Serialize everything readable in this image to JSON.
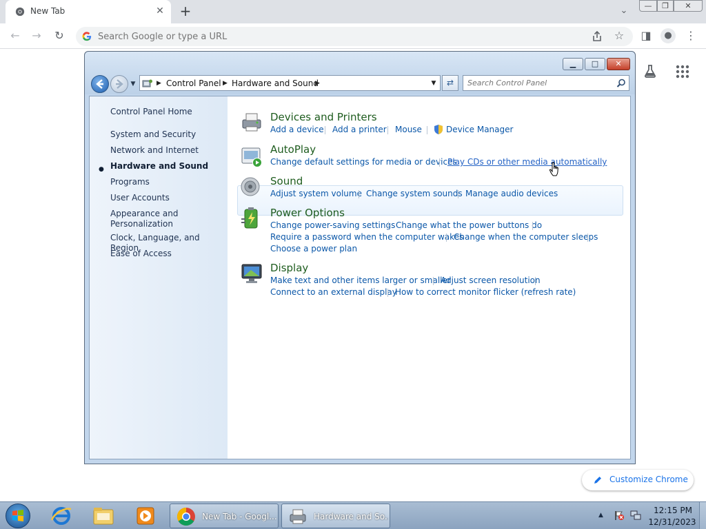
{
  "chrome": {
    "tab_title": "New Tab",
    "tab_close": "✕",
    "new_tab": "+",
    "omnibox_placeholder": "Search Google or type a URL",
    "customize_label": "Customize Chrome"
  },
  "window": {
    "breadcrumb": [
      "Control Panel",
      "Hardware and Sound"
    ],
    "search_placeholder": "Search Control Panel"
  },
  "nav": {
    "home": "Control Panel Home",
    "items": [
      "System and Security",
      "Network and Internet",
      "Hardware and Sound",
      "Programs",
      "User Accounts",
      "Appearance and",
      "Personalization",
      "Clock, Language, and Region",
      "Ease of Access"
    ]
  },
  "categories": {
    "devices": {
      "title": "Devices and Printers",
      "links": [
        "Add a device",
        "Add a printer",
        "Mouse",
        "Device Manager"
      ]
    },
    "autoplay": {
      "title": "AutoPlay",
      "links": [
        "Change default settings for media or devices",
        "Play CDs or other media automatically"
      ]
    },
    "sound": {
      "title": "Sound",
      "links": [
        "Adjust system volume",
        "Change system sounds",
        "Manage audio devices"
      ]
    },
    "power": {
      "title": "Power Options",
      "links": [
        "Change power-saving settings",
        "Change what the power buttons do",
        "Require a password when the computer wakes",
        "Change when the computer sleeps",
        "Choose a power plan"
      ]
    },
    "display": {
      "title": "Display",
      "links": [
        "Make text and other items larger or smaller",
        "Adjust screen resolution",
        "Connect to an external display",
        "How to correct monitor flicker (refresh rate)"
      ]
    }
  },
  "taskbar": {
    "apps": [
      "New Tab - Googl...",
      "Hardware and So..."
    ],
    "time": "12:15 PM",
    "date": "12/31/2023"
  },
  "colors": {
    "link": "#0b57a8",
    "category_title": "#1e5c1e",
    "chrome_accent": "#1a73e8"
  }
}
